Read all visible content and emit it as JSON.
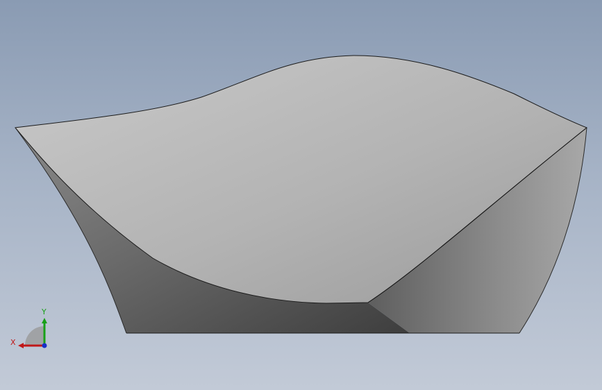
{
  "viewport": {
    "background_top": "#8a9bb3",
    "background_bottom": "#c2cad7"
  },
  "model": {
    "surface_light": "#c4c4c4",
    "surface_mid": "#a8a8a8",
    "surface_dark": "#5a5a5a",
    "edge_color": "#1a1a1a"
  },
  "triad": {
    "x_label": "X",
    "y_label": "Y",
    "x_color": "#c01818",
    "y_color": "#18a018",
    "z_color": "#1830c8"
  }
}
